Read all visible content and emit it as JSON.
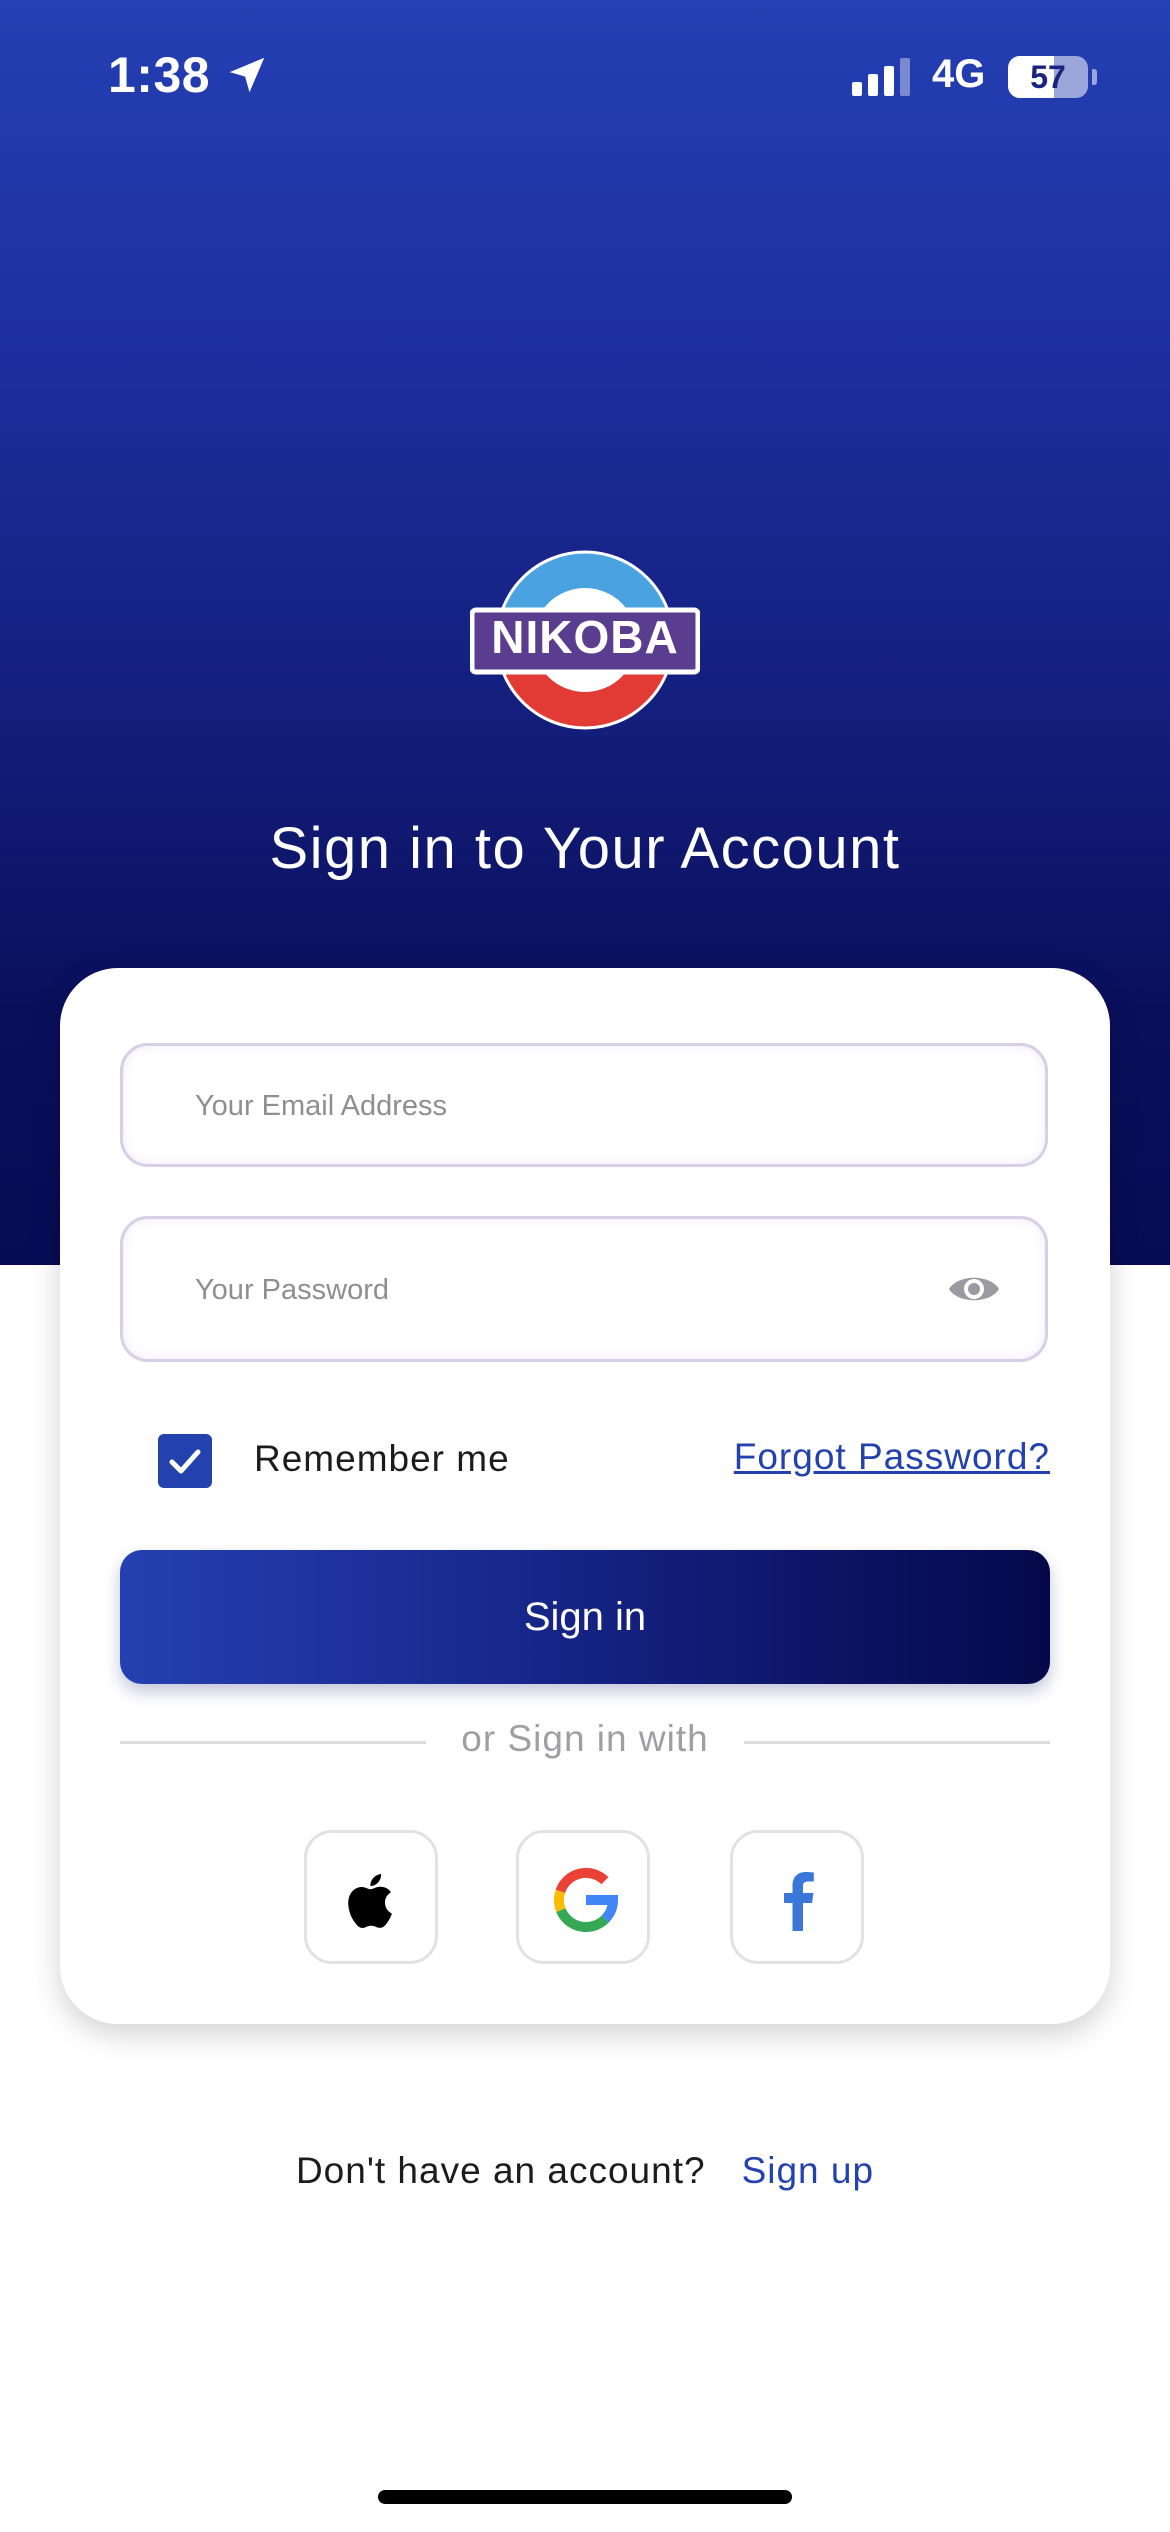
{
  "status_bar": {
    "time": "1:38",
    "network": "4G",
    "battery": "57",
    "battery_level": 0.57
  },
  "logo": {
    "text": "NIKOBA"
  },
  "title": "Sign in to Your Account",
  "form": {
    "email_placeholder": "Your Email Address",
    "password_placeholder": "Your Password",
    "remember_label": "Remember me",
    "remember_checked": true,
    "forgot_label": "Forgot Password?",
    "signin_label": "Sign in",
    "divider_text": "or Sign in with"
  },
  "social": [
    {
      "name": "apple",
      "icon": "apple-icon"
    },
    {
      "name": "google",
      "icon": "google-icon"
    },
    {
      "name": "facebook",
      "icon": "facebook-icon"
    }
  ],
  "footer": {
    "question": "Don't have an account?",
    "signup_label": "Sign up"
  },
  "colors": {
    "primary": "#2342ad",
    "gradient_dark": "#05084a",
    "field_border": "#d5cfe8"
  }
}
